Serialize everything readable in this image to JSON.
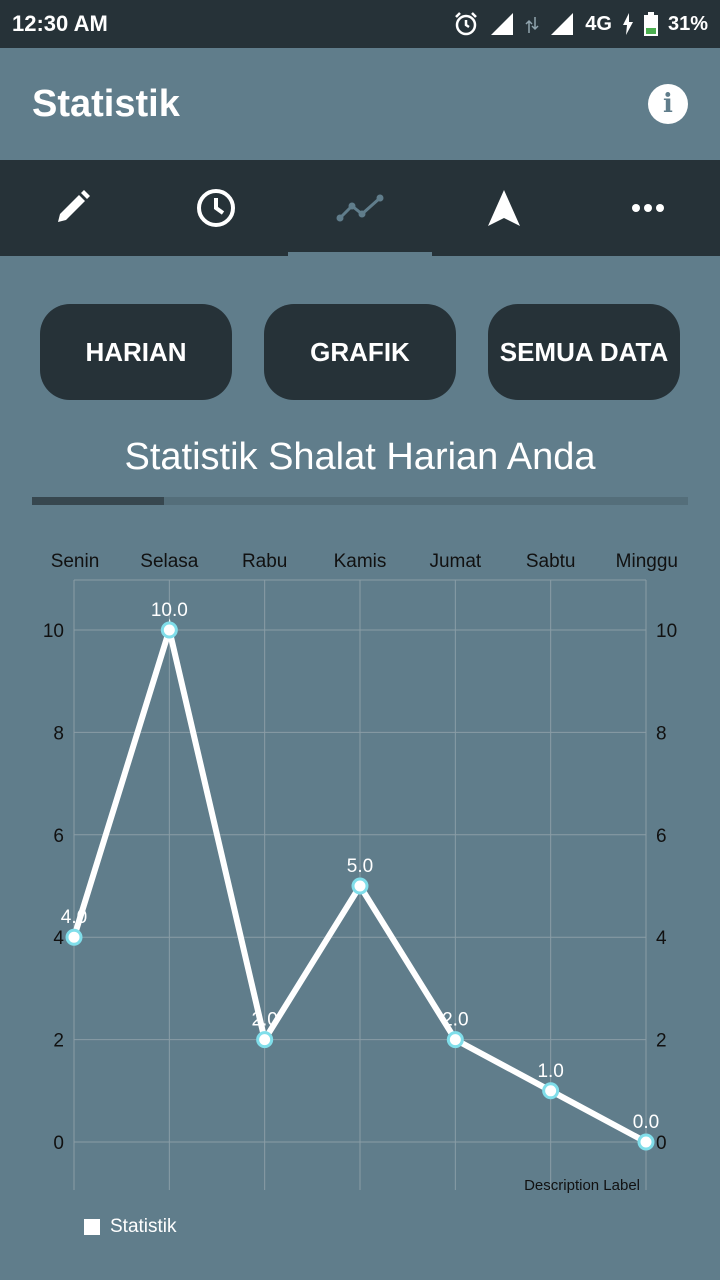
{
  "status": {
    "time": "12:30 AM",
    "network": "4G",
    "battery": "31%",
    "icons": [
      "alarm-icon",
      "signal-icon",
      "data-arrows-icon",
      "signal-icon",
      "charging-icon",
      "battery-icon"
    ]
  },
  "appbar": {
    "title": "Statistik",
    "info_icon": "info-icon",
    "info_glyph": "i"
  },
  "tabs": [
    {
      "icon": "pencil-icon"
    },
    {
      "icon": "clock-icon"
    },
    {
      "icon": "chart-line-icon",
      "active": true
    },
    {
      "icon": "navigation-arrow-icon"
    },
    {
      "icon": "more-dots-icon"
    }
  ],
  "buttons": {
    "daily": "HARIAN",
    "chart": "GRAFIK",
    "all": "SEMUA DATA"
  },
  "heading": "Statistik Shalat Harian Anda",
  "colors": {
    "background": "#607d8b",
    "dark": "#263238",
    "line": "#ffffff",
    "point_ring": "#80deea"
  },
  "chart_data": {
    "type": "line",
    "categories": [
      "Senin",
      "Selasa",
      "Rabu",
      "Kamis",
      "Jumat",
      "Sabtu",
      "Minggu"
    ],
    "series": [
      {
        "name": "Statistik",
        "values": [
          4.0,
          10.0,
          2.0,
          5.0,
          2.0,
          1.0,
          0.0
        ]
      }
    ],
    "value_labels": [
      "4.0",
      "10.0",
      "2.0",
      "5.0",
      "2.0",
      "1.0",
      "0.0"
    ],
    "ylim": [
      0,
      10
    ],
    "yticks": [
      "0",
      "2",
      "4",
      "6",
      "8",
      "10"
    ],
    "x_axis_position": "top",
    "y_axes": "left and right",
    "grid": true,
    "description": "Description Label",
    "legend_position": "bottom-left"
  }
}
